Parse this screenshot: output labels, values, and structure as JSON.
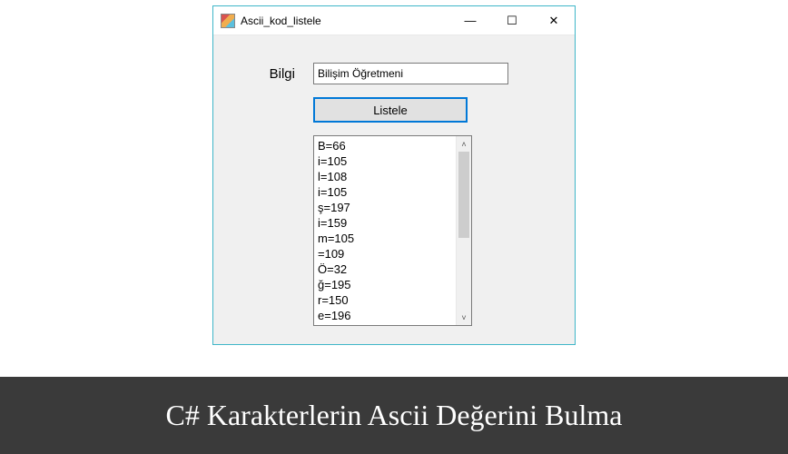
{
  "window": {
    "title": "Ascii_kod_listele",
    "minimize": "—",
    "maximize": "☐",
    "close": "✕"
  },
  "form": {
    "label": "Bilgi",
    "input_value": "Bilişim Öğretmeni",
    "button_label": "Listele",
    "scrollbar": {
      "up": "˄",
      "down": "˅"
    }
  },
  "listItems": [
    "B=66",
    "i=105",
    "l=108",
    "i=105",
    "ş=197",
    "i=159",
    "m=105",
    " =109",
    "Ö=32",
    "ğ=195",
    "r=150",
    "e=196"
  ],
  "banner": {
    "text": "C# Karakterlerin Ascii Değerini Bulma"
  }
}
